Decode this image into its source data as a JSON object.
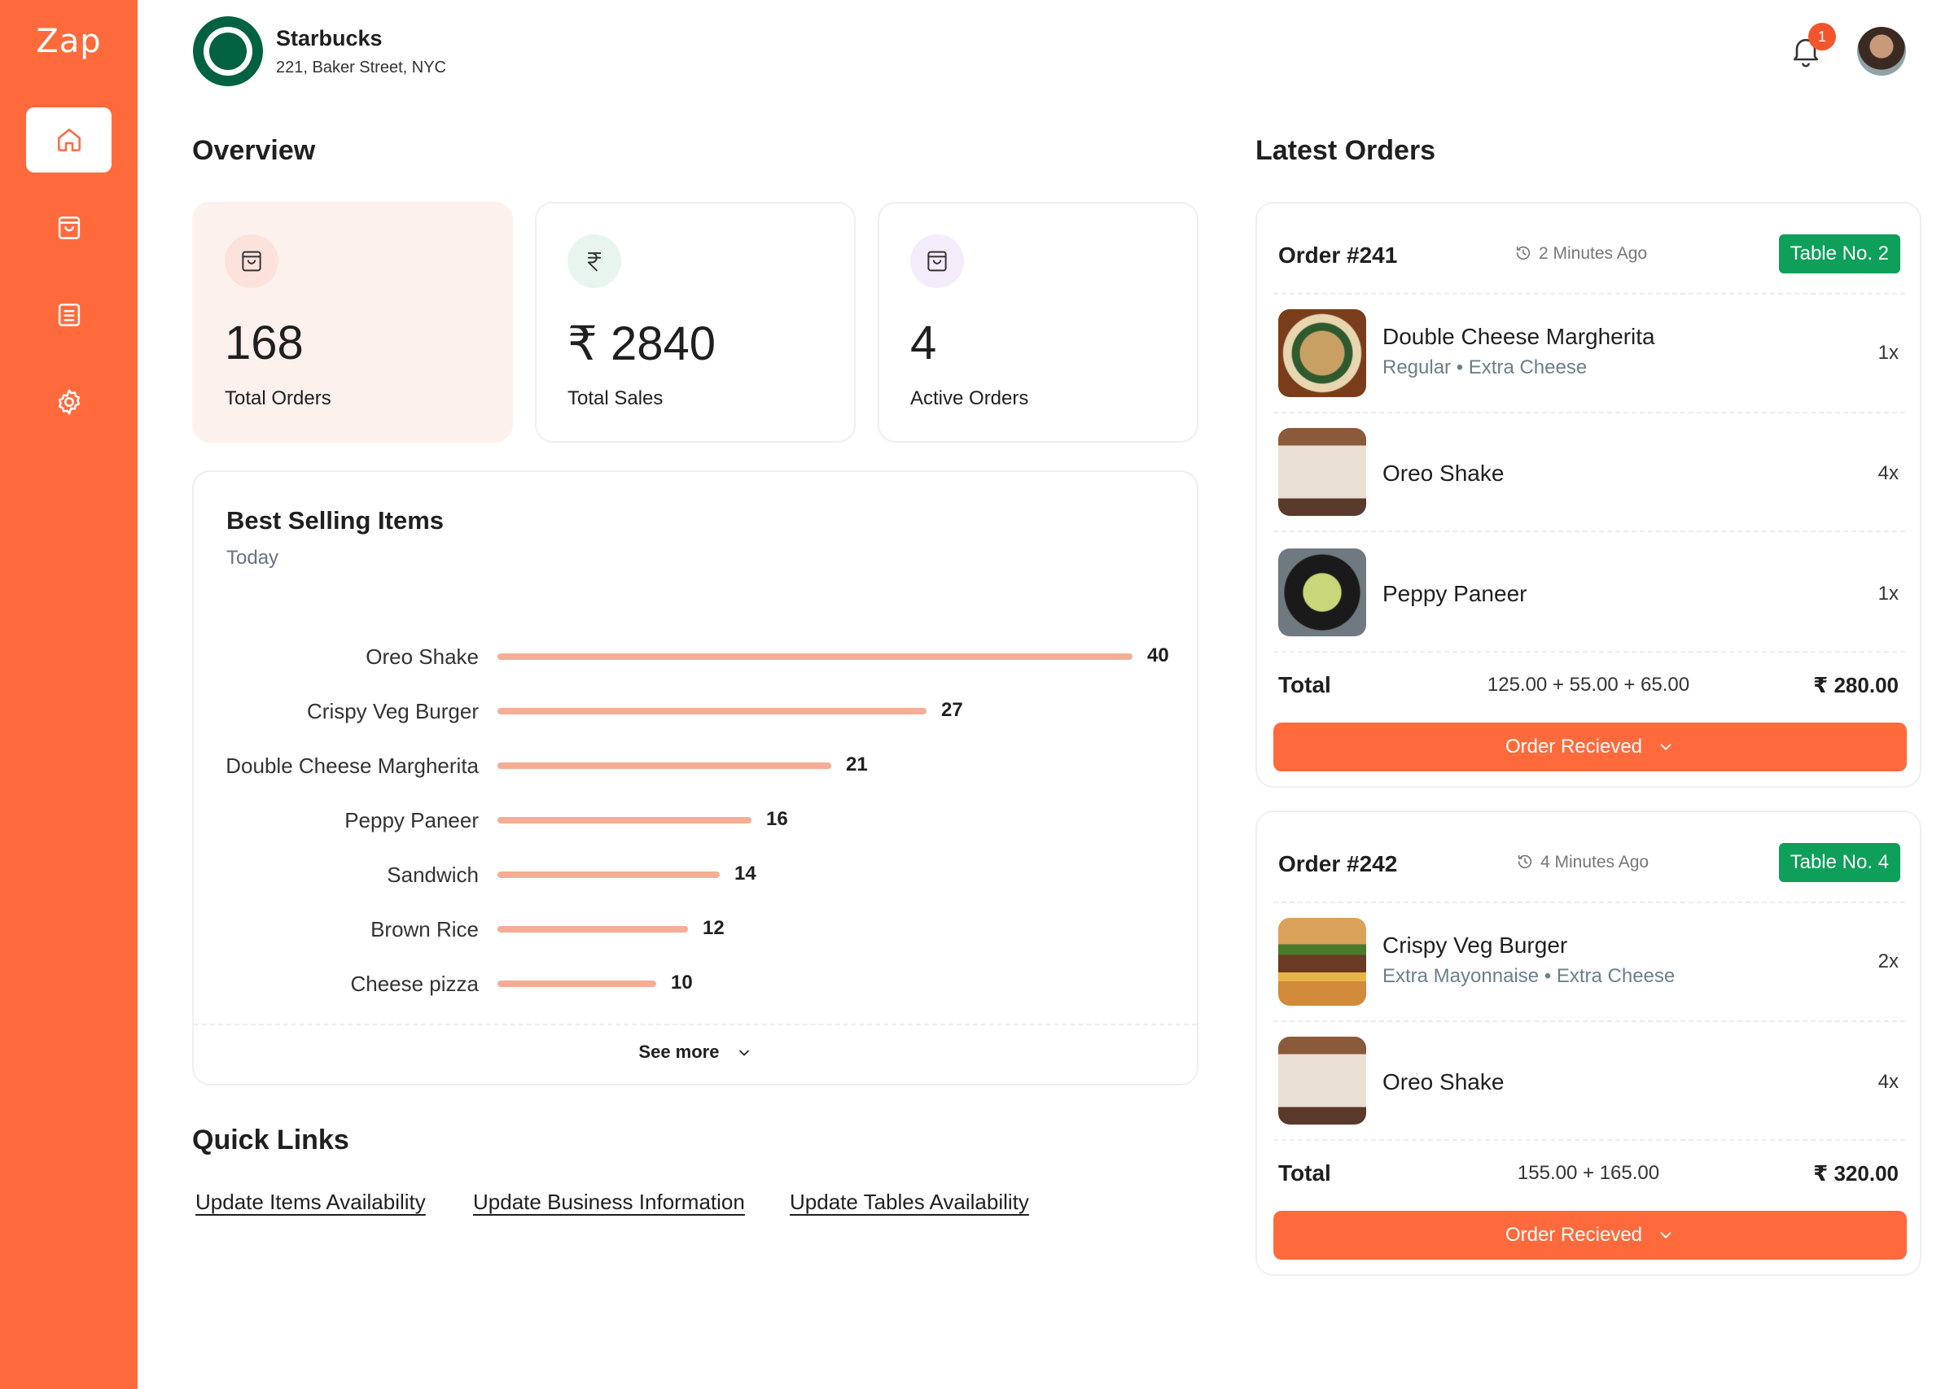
{
  "app": {
    "logo": "Zap"
  },
  "sidebar": {
    "items": [
      {
        "name": "home",
        "icon": "home-icon",
        "active": true
      },
      {
        "name": "orders",
        "icon": "shopping-bag-icon",
        "active": false
      },
      {
        "name": "menu",
        "icon": "list-icon",
        "active": false
      },
      {
        "name": "settings",
        "icon": "gear-icon",
        "active": false
      }
    ]
  },
  "header": {
    "business_name": "Starbucks",
    "address": "221, Baker Street, NYC",
    "notification_count": "1"
  },
  "overview": {
    "title": "Overview",
    "stats": [
      {
        "value": "168",
        "label": "Total Orders",
        "icon": "shopping-bag-icon"
      },
      {
        "value": "₹ 2840",
        "label": "Total Sales",
        "icon": "rupee-icon"
      },
      {
        "value": "4",
        "label": "Active Orders",
        "icon": "shopping-bag-icon"
      }
    ]
  },
  "best_selling": {
    "title": "Best Selling Items",
    "subtitle": "Today",
    "see_more": "See more",
    "chart_data": {
      "type": "bar",
      "orientation": "horizontal",
      "categories": [
        "Oreo Shake",
        "Crispy Veg Burger",
        "Double Cheese Margherita",
        "Peppy Paneer",
        "Sandwich",
        "Brown Rice",
        "Cheese pizza"
      ],
      "values": [
        40,
        27,
        21,
        16,
        14,
        12,
        10
      ],
      "title": "Best Selling Items",
      "xlabel": "",
      "ylabel": "",
      "grid": false
    }
  },
  "quick_links": {
    "title": "Quick Links",
    "links": [
      "Update Items Availability",
      "Update Business Information",
      "Update Tables Availability"
    ]
  },
  "latest_orders": {
    "title": "Latest Orders",
    "orders": [
      {
        "number": "Order #241",
        "time": "2 Minutes Ago",
        "table": "Table No. 2",
        "items": [
          {
            "name": "Double Cheese Margherita",
            "options": "Regular • Extra Cheese",
            "qty": "1x",
            "image": "pizza"
          },
          {
            "name": "Oreo Shake",
            "options": "",
            "qty": "4x",
            "image": "shake"
          },
          {
            "name": "Peppy Paneer",
            "options": "",
            "qty": "1x",
            "image": "paneer"
          }
        ],
        "total_label": "Total",
        "total_breakdown": "125.00 + 55.00 + 65.00",
        "total_amount": "₹ 280.00",
        "status": "Order Recieved"
      },
      {
        "number": "Order #242",
        "time": "4 Minutes Ago",
        "table": "Table No. 4",
        "items": [
          {
            "name": "Crispy Veg Burger",
            "options": "Extra Mayonnaise • Extra Cheese",
            "qty": "2x",
            "image": "burger"
          },
          {
            "name": "Oreo Shake",
            "options": "",
            "qty": "4x",
            "image": "shake"
          }
        ],
        "total_label": "Total",
        "total_breakdown": "155.00 + 165.00",
        "total_amount": "₹ 320.00",
        "status": "Order Recieved"
      }
    ]
  },
  "colors": {
    "accent": "#FF6A3D",
    "bar": "#F5AD96",
    "table_badge": "#0E9F5A",
    "highlight_card": "#FDF1EE"
  }
}
